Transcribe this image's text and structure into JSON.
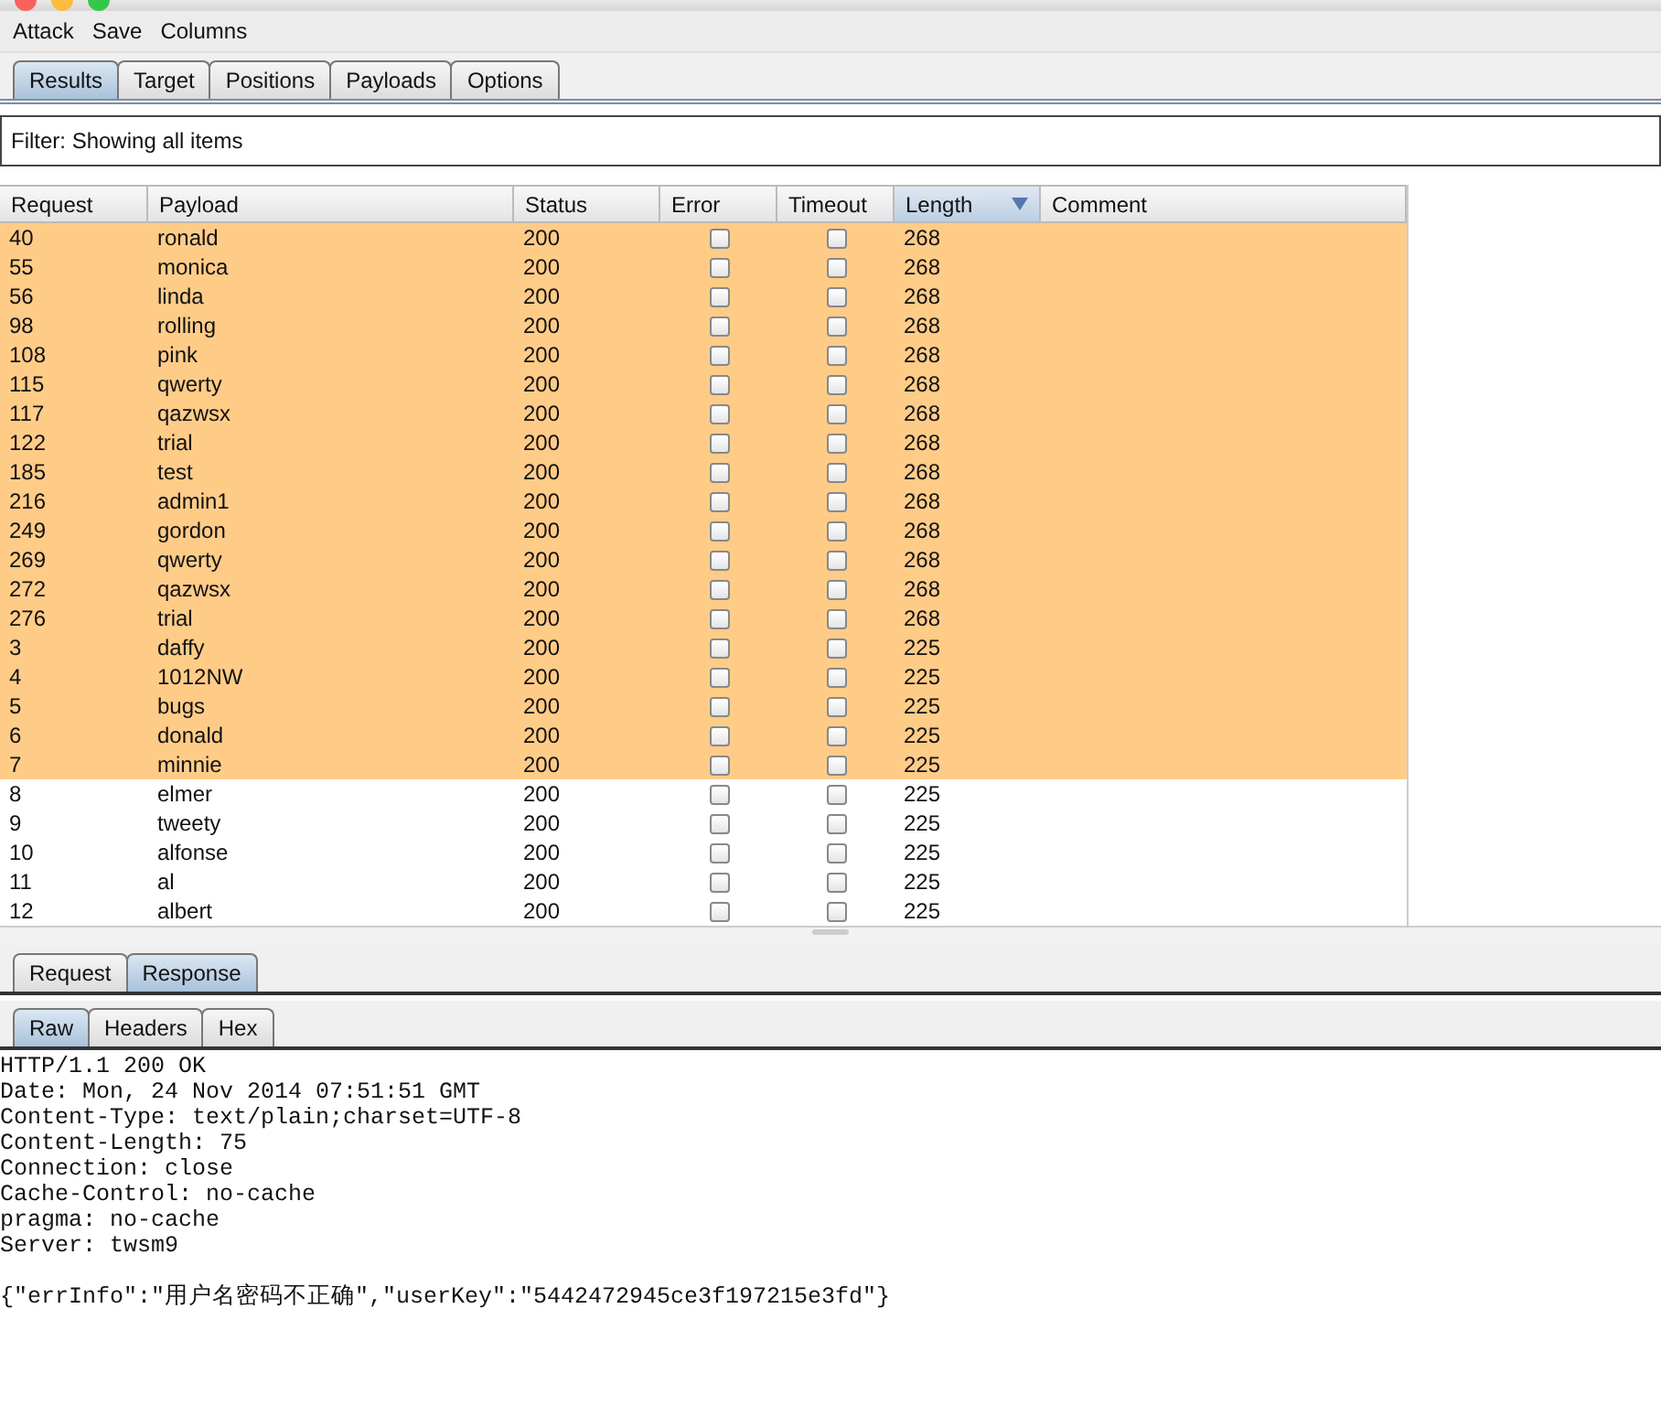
{
  "menu": [
    "Attack",
    "Save",
    "Columns"
  ],
  "tabs": [
    {
      "label": "Results",
      "selected": true
    },
    {
      "label": "Target",
      "selected": false
    },
    {
      "label": "Positions",
      "selected": false
    },
    {
      "label": "Payloads",
      "selected": false
    },
    {
      "label": "Options",
      "selected": false
    }
  ],
  "filter": "Filter: Showing all items",
  "table": {
    "columns": [
      {
        "label": "Request",
        "sorted": false
      },
      {
        "label": "Payload",
        "sorted": false
      },
      {
        "label": "Status",
        "sorted": false
      },
      {
        "label": "Error",
        "sorted": false
      },
      {
        "label": "Timeout",
        "sorted": false
      },
      {
        "label": "Length",
        "sorted": true
      },
      {
        "label": "Comment",
        "sorted": false
      }
    ],
    "rows": [
      {
        "request": "40",
        "payload": "ronald",
        "status": "200",
        "error": false,
        "timeout": false,
        "length": "268",
        "highlighted": true
      },
      {
        "request": "55",
        "payload": "monica",
        "status": "200",
        "error": false,
        "timeout": false,
        "length": "268",
        "highlighted": true
      },
      {
        "request": "56",
        "payload": "linda",
        "status": "200",
        "error": false,
        "timeout": false,
        "length": "268",
        "highlighted": true
      },
      {
        "request": "98",
        "payload": "rolling",
        "status": "200",
        "error": false,
        "timeout": false,
        "length": "268",
        "highlighted": true
      },
      {
        "request": "108",
        "payload": "pink",
        "status": "200",
        "error": false,
        "timeout": false,
        "length": "268",
        "highlighted": true
      },
      {
        "request": "115",
        "payload": "qwerty",
        "status": "200",
        "error": false,
        "timeout": false,
        "length": "268",
        "highlighted": true
      },
      {
        "request": "117",
        "payload": "qazwsx",
        "status": "200",
        "error": false,
        "timeout": false,
        "length": "268",
        "highlighted": true
      },
      {
        "request": "122",
        "payload": "trial",
        "status": "200",
        "error": false,
        "timeout": false,
        "length": "268",
        "highlighted": true
      },
      {
        "request": "185",
        "payload": "test",
        "status": "200",
        "error": false,
        "timeout": false,
        "length": "268",
        "highlighted": true
      },
      {
        "request": "216",
        "payload": "admin1",
        "status": "200",
        "error": false,
        "timeout": false,
        "length": "268",
        "highlighted": true
      },
      {
        "request": "249",
        "payload": "gordon",
        "status": "200",
        "error": false,
        "timeout": false,
        "length": "268",
        "highlighted": true
      },
      {
        "request": "269",
        "payload": "qwerty",
        "status": "200",
        "error": false,
        "timeout": false,
        "length": "268",
        "highlighted": true
      },
      {
        "request": "272",
        "payload": "qazwsx",
        "status": "200",
        "error": false,
        "timeout": false,
        "length": "268",
        "highlighted": true
      },
      {
        "request": "276",
        "payload": "trial",
        "status": "200",
        "error": false,
        "timeout": false,
        "length": "268",
        "highlighted": true
      },
      {
        "request": "3",
        "payload": "daffy",
        "status": "200",
        "error": false,
        "timeout": false,
        "length": "225",
        "highlighted": true
      },
      {
        "request": "4",
        "payload": "1012NW",
        "status": "200",
        "error": false,
        "timeout": false,
        "length": "225",
        "highlighted": true
      },
      {
        "request": "5",
        "payload": "bugs",
        "status": "200",
        "error": false,
        "timeout": false,
        "length": "225",
        "highlighted": true
      },
      {
        "request": "6",
        "payload": "donald",
        "status": "200",
        "error": false,
        "timeout": false,
        "length": "225",
        "highlighted": true
      },
      {
        "request": "7",
        "payload": "minnie",
        "status": "200",
        "error": false,
        "timeout": false,
        "length": "225",
        "highlighted": true
      },
      {
        "request": "8",
        "payload": "elmer",
        "status": "200",
        "error": false,
        "timeout": false,
        "length": "225",
        "highlighted": false
      },
      {
        "request": "9",
        "payload": "tweety",
        "status": "200",
        "error": false,
        "timeout": false,
        "length": "225",
        "highlighted": false
      },
      {
        "request": "10",
        "payload": "alfonse",
        "status": "200",
        "error": false,
        "timeout": false,
        "length": "225",
        "highlighted": false
      },
      {
        "request": "11",
        "payload": "al",
        "status": "200",
        "error": false,
        "timeout": false,
        "length": "225",
        "highlighted": false
      },
      {
        "request": "12",
        "payload": "albert",
        "status": "200",
        "error": false,
        "timeout": false,
        "length": "225",
        "highlighted": false
      }
    ]
  },
  "message_tabs": [
    {
      "label": "Request",
      "selected": false
    },
    {
      "label": "Response",
      "selected": true
    }
  ],
  "view_tabs": [
    {
      "label": "Raw",
      "selected": true
    },
    {
      "label": "Headers",
      "selected": false
    },
    {
      "label": "Hex",
      "selected": false
    }
  ],
  "response": {
    "headers": [
      "HTTP/1.1 200 OK",
      "Date: Mon, 24 Nov 2014 07:51:51 GMT",
      "Content-Type: text/plain;charset=UTF-8",
      "Content-Length: 75",
      "Connection: close",
      "Cache-Control: no-cache",
      "pragma: no-cache",
      "Server: twsm9"
    ],
    "body": "{\"errInfo\":\"用户名密码不正确\",\"userKey\":\"5442472945ce3f197215e3fd\"}"
  }
}
